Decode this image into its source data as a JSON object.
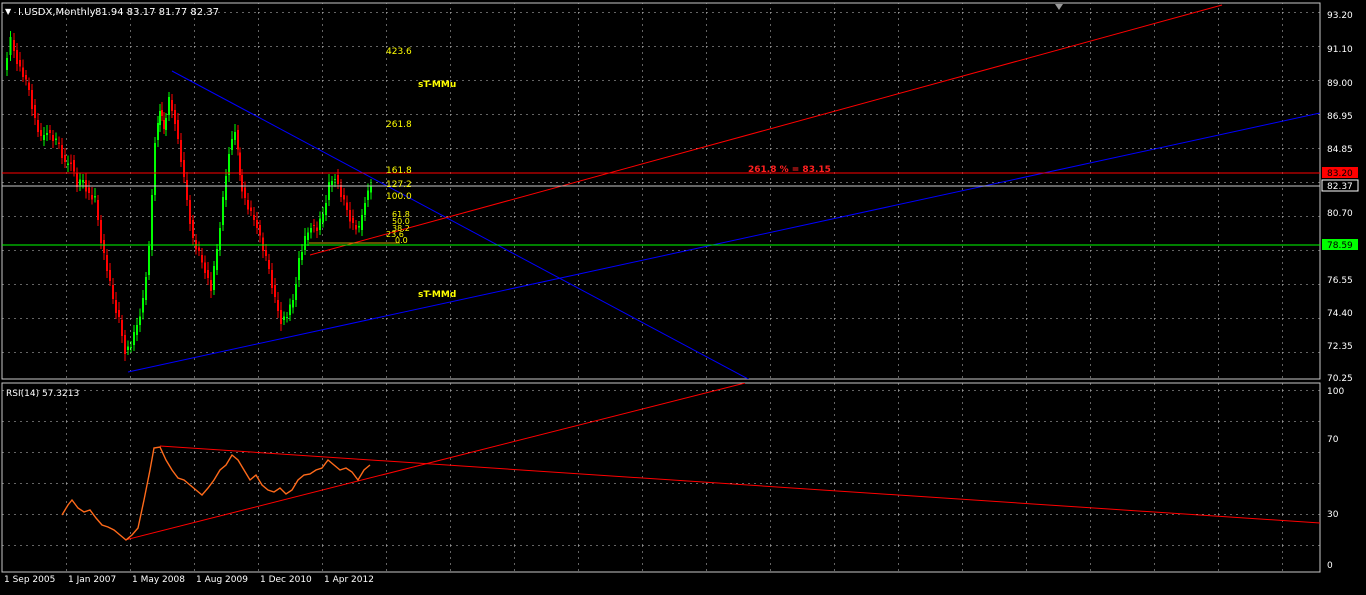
{
  "window": {
    "menu_glyph": "▼",
    "title": "I.USDX,Monthly",
    "ohlc": "81.94 83.17 81.77 82.37"
  },
  "rsi_panel": {
    "title": "RSI(14) 57.3213",
    "levels": [
      "100",
      "70",
      "30",
      "0"
    ]
  },
  "price_axis": {
    "labels": [
      "93.20",
      "91.10",
      "89.00",
      "86.95",
      "84.85",
      "82.37",
      "80.70",
      "78.59",
      "76.55",
      "74.40",
      "72.35",
      "70.25"
    ],
    "current_price": "82.37",
    "red_level": "83.20",
    "green_level": "78.59"
  },
  "date_axis": {
    "labels": [
      "1 Sep 2005",
      "1 Jan 2007",
      "1 May 2008",
      "1 Aug 2009",
      "1 Dec 2010",
      "1 Apr 2012"
    ]
  },
  "fibo": {
    "upper_levels": [
      "423.6",
      "261.8",
      "161.8",
      "127.2",
      "100.0"
    ],
    "lower_levels": [
      "61.8",
      "50.0",
      "38.2",
      "23.6",
      "0.0"
    ],
    "target_text": "261.8 % = 83.15",
    "mm_upper": "sT-MMu",
    "mm_lower": "sT-MMd"
  },
  "colors": {
    "background": "#000000",
    "grid": "#c8c8c8",
    "bull_candle": "#00ff00",
    "bear_candle": "#ff0000",
    "channel_blue": "#0000ff",
    "channel_red": "#ff0000",
    "rsi_line": "#ff6a1a",
    "fib_text": "#ffff00",
    "axis_text": "#ffffff"
  }
}
